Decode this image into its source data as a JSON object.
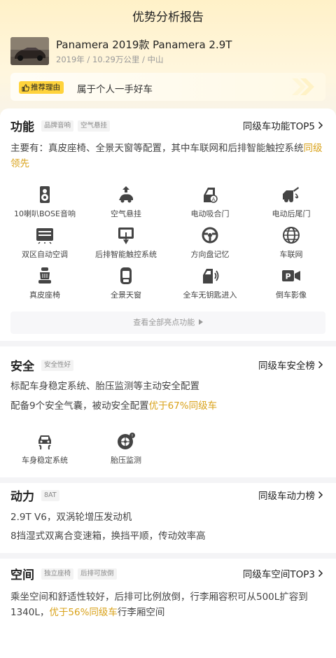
{
  "header": {
    "title": "优势分析报告"
  },
  "car": {
    "name": "Panamera 2019款 Panamera 2.9T",
    "meta": "2019年 / 10.29万公里 / 中山"
  },
  "reason": {
    "tag": "推荐理由",
    "text": "属于个人一手好车"
  },
  "function": {
    "title": "功能",
    "chips": [
      "品牌音响",
      "空气悬挂"
    ],
    "link": "同级车功能TOP5",
    "desc_prefix": "主要有：真皮座椅、全景天窗等配置，其中车联网和后排智能触控系统",
    "desc_highlight": "同级领先",
    "items": [
      {
        "label": "10喇叭BOSE音响",
        "icon": "speaker-icon"
      },
      {
        "label": "空气悬挂",
        "icon": "air-suspension-icon"
      },
      {
        "label": "电动吸合门",
        "icon": "power-door-icon"
      },
      {
        "label": "电动后尾门",
        "icon": "power-tailgate-icon"
      },
      {
        "label": "双区自动空调",
        "icon": "dual-zone-ac-icon"
      },
      {
        "label": "后排智能触控系统",
        "icon": "rear-touch-control-icon"
      },
      {
        "label": "方向盘记忆",
        "icon": "steering-memory-icon"
      },
      {
        "label": "车联网",
        "icon": "connected-car-icon"
      },
      {
        "label": "真皮座椅",
        "icon": "leather-seat-icon"
      },
      {
        "label": "全景天窗",
        "icon": "panoramic-sunroof-icon"
      },
      {
        "label": "全车无钥匙进入",
        "icon": "keyless-entry-icon"
      },
      {
        "label": "倒车影像",
        "icon": "reverse-camera-icon"
      }
    ],
    "view_all": "查看全部亮点功能"
  },
  "safety": {
    "title": "安全",
    "chips": [
      "安全性好"
    ],
    "link": "同级车安全榜",
    "line1": "标配车身稳定系统、胎压监测等主动安全配置",
    "line2_prefix": "配备9个安全气囊，被动安全配置",
    "line2_highlight": "优于67%同级车",
    "items": [
      {
        "label": "车身稳定系统",
        "icon": "stability-control-icon"
      },
      {
        "label": "胎压监测",
        "icon": "tire-pressure-icon"
      }
    ]
  },
  "power": {
    "title": "动力",
    "chips": [
      "8AT"
    ],
    "link": "同级车动力榜",
    "line1": "2.9T V6，双涡轮增压发动机",
    "line2": "8挡湿式双离合变速箱，换挡平顺，传动效率高"
  },
  "space": {
    "title": "空间",
    "chips": [
      "独立座椅",
      "后排可放倒"
    ],
    "link": "同级车空间TOP3",
    "desc_prefix": "乘坐空间和舒适性较好，后排可比例放倒，行李厢容积可从500L扩容到1340L，",
    "desc_highlight": "优于56%同级车",
    "desc_suffix": "行李厢空间"
  },
  "colors": {
    "accent": "#ffd33b",
    "highlight": "#d9a21a"
  }
}
